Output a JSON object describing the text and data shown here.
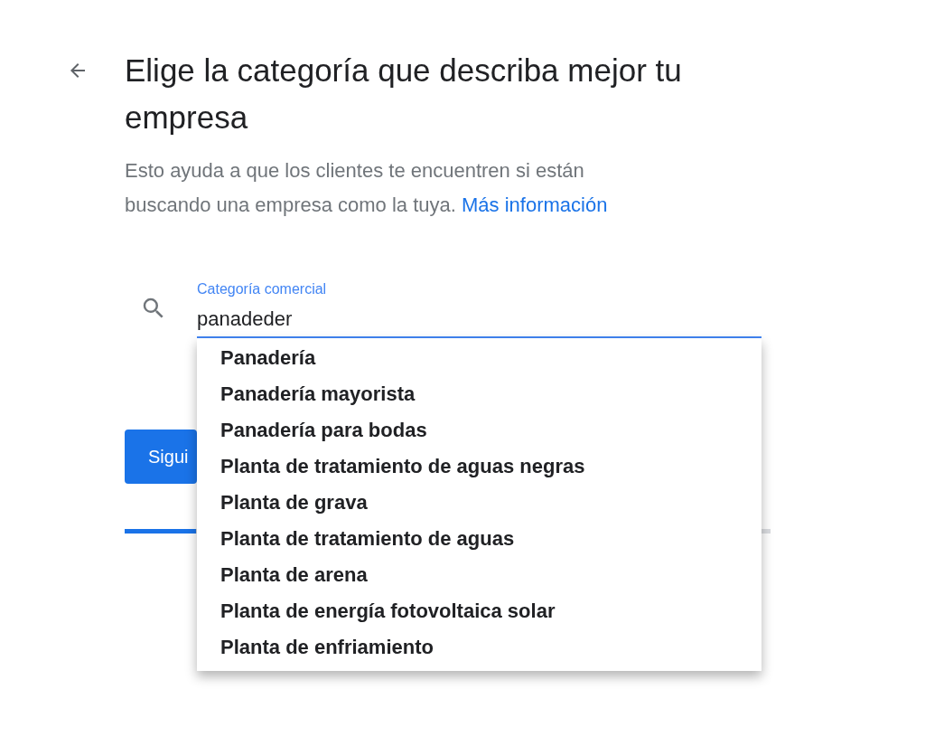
{
  "title": "Elige la categoría que describa mejor tu empresa",
  "description": {
    "text": "Esto ayuda a que los clientes te encuentren si están buscando una empresa como la tuya.",
    "link": "Más información"
  },
  "field": {
    "label": "Categoría comercial",
    "value": "panadeder",
    "focused": true
  },
  "suggestions": [
    "Panadería",
    "Panadería mayorista",
    "Panadería para bodas",
    "Planta de tratamiento de aguas negras",
    "Planta de grava",
    "Planta de tratamiento de aguas",
    "Planta de arena",
    "Planta de energía fotovoltaica solar",
    "Planta de enfriamiento"
  ],
  "next_button": {
    "label": "Sigui"
  },
  "progress": {
    "level": 0.11
  }
}
